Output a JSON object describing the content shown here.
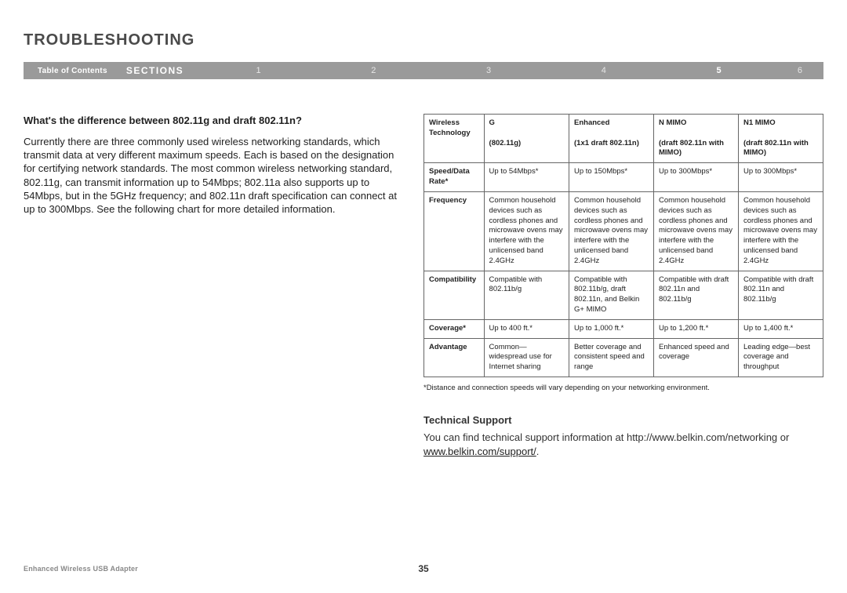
{
  "title": "TROUBLESHOOTING",
  "nav": {
    "toc": "Table of Contents",
    "sections": "SECTIONS",
    "nums": [
      "1",
      "2",
      "3",
      "4",
      "5",
      "6"
    ],
    "active": "5"
  },
  "question": "What's the difference between 802.11g and draft 802.11n?",
  "body": "Currently there are three commonly used wireless networking standards, which transmit data at very different maximum speeds. Each is based on the designation for certifying network standards. The most common wireless networking standard, 802.11g, can transmit information up to 54Mbps; 802.11a also supports up to 54Mbps, but in the 5GHz frequency; and 802.11n draft specification can connect at up to 300Mbps. See the following chart for more detailed information.",
  "table": {
    "headers": {
      "c0": "Wireless Technology",
      "c1a": "G",
      "c1b": "(802.11g)",
      "c2a": "Enhanced",
      "c2b": "(1x1 draft 802.11n)",
      "c3a": "N MIMO",
      "c3b": "(draft 802.11n with MIMO)",
      "c4a": "N1 MIMO",
      "c4b": "(draft 802.11n with MIMO)"
    },
    "rows": [
      {
        "label": "Speed/Data Rate*",
        "c1": "Up to 54Mbps*",
        "c2": "Up to 150Mbps*",
        "c3": "Up to 300Mbps*",
        "c4": "Up to 300Mbps*"
      },
      {
        "label": "Frequency",
        "c1": "Common household devices such as cordless phones and microwave ovens may interfere with the unlicensed band 2.4GHz",
        "c2": "Common household devices such as cordless phones and microwave ovens may interfere with the unlicensed band 2.4GHz",
        "c3": "Common household devices such as cordless phones and microwave ovens may interfere with the unlicensed band 2.4GHz",
        "c4": "Common household devices such as cordless phones and microwave ovens may interfere with the unlicensed band 2.4GHz"
      },
      {
        "label": "Compatibility",
        "c1": "Compatible with 802.11b/g",
        "c2": "Compatible with 802.11b/g, draft 802.11n, and Belkin G+ MIMO",
        "c3": "Compatible with draft 802.11n and 802.11b/g",
        "c4": "Compatible with draft 802.11n and 802.11b/g"
      },
      {
        "label": "Coverage*",
        "c1": "Up to 400 ft.*",
        "c2": "Up to 1,000 ft.*",
        "c3": "Up to 1,200 ft.*",
        "c4": "Up to 1,400 ft.*"
      },
      {
        "label": "Advantage",
        "c1": "Common—widespread use for Internet sharing",
        "c2": "Better coverage and consistent speed and range",
        "c3": "Enhanced speed and coverage",
        "c4": "Leading edge—best coverage and throughput"
      }
    ]
  },
  "footnote": "*Distance and connection speeds will vary depending on your networking environment.",
  "tech": {
    "heading": "Technical Support",
    "text1": "You can find technical support information at http://www.belkin.com/networking or ",
    "link": "www.belkin.com/support/",
    "text2": "."
  },
  "footer": {
    "product": "Enhanced Wireless USB Adapter",
    "page": "35"
  },
  "chart_data": {
    "type": "table",
    "title": "Wireless Technology Comparison",
    "columns": [
      "Wireless Technology",
      "G (802.11g)",
      "Enhanced (1x1 draft 802.11n)",
      "N MIMO (draft 802.11n with MIMO)",
      "N1 MIMO (draft 802.11n with MIMO)"
    ],
    "rows": [
      [
        "Speed/Data Rate*",
        "Up to 54Mbps*",
        "Up to 150Mbps*",
        "Up to 300Mbps*",
        "Up to 300Mbps*"
      ],
      [
        "Frequency",
        "Common household devices such as cordless phones and microwave ovens may interfere with the unlicensed band 2.4GHz",
        "Common household devices such as cordless phones and microwave ovens may interfere with the unlicensed band 2.4GHz",
        "Common household devices such as cordless phones and microwave ovens may interfere with the unlicensed band 2.4GHz",
        "Common household devices such as cordless phones and microwave ovens may interfere with the unlicensed band 2.4GHz"
      ],
      [
        "Compatibility",
        "Compatible with 802.11b/g",
        "Compatible with 802.11b/g, draft 802.11n, and Belkin G+ MIMO",
        "Compatible with draft 802.11n and 802.11b/g",
        "Compatible with draft 802.11n and 802.11b/g"
      ],
      [
        "Coverage*",
        "Up to 400 ft.*",
        "Up to 1,000 ft.*",
        "Up to 1,200 ft.*",
        "Up to 1,400 ft.*"
      ],
      [
        "Advantage",
        "Common—widespread use for Internet sharing",
        "Better coverage and consistent speed and range",
        "Enhanced speed and coverage",
        "Leading edge—best coverage and throughput"
      ]
    ]
  }
}
